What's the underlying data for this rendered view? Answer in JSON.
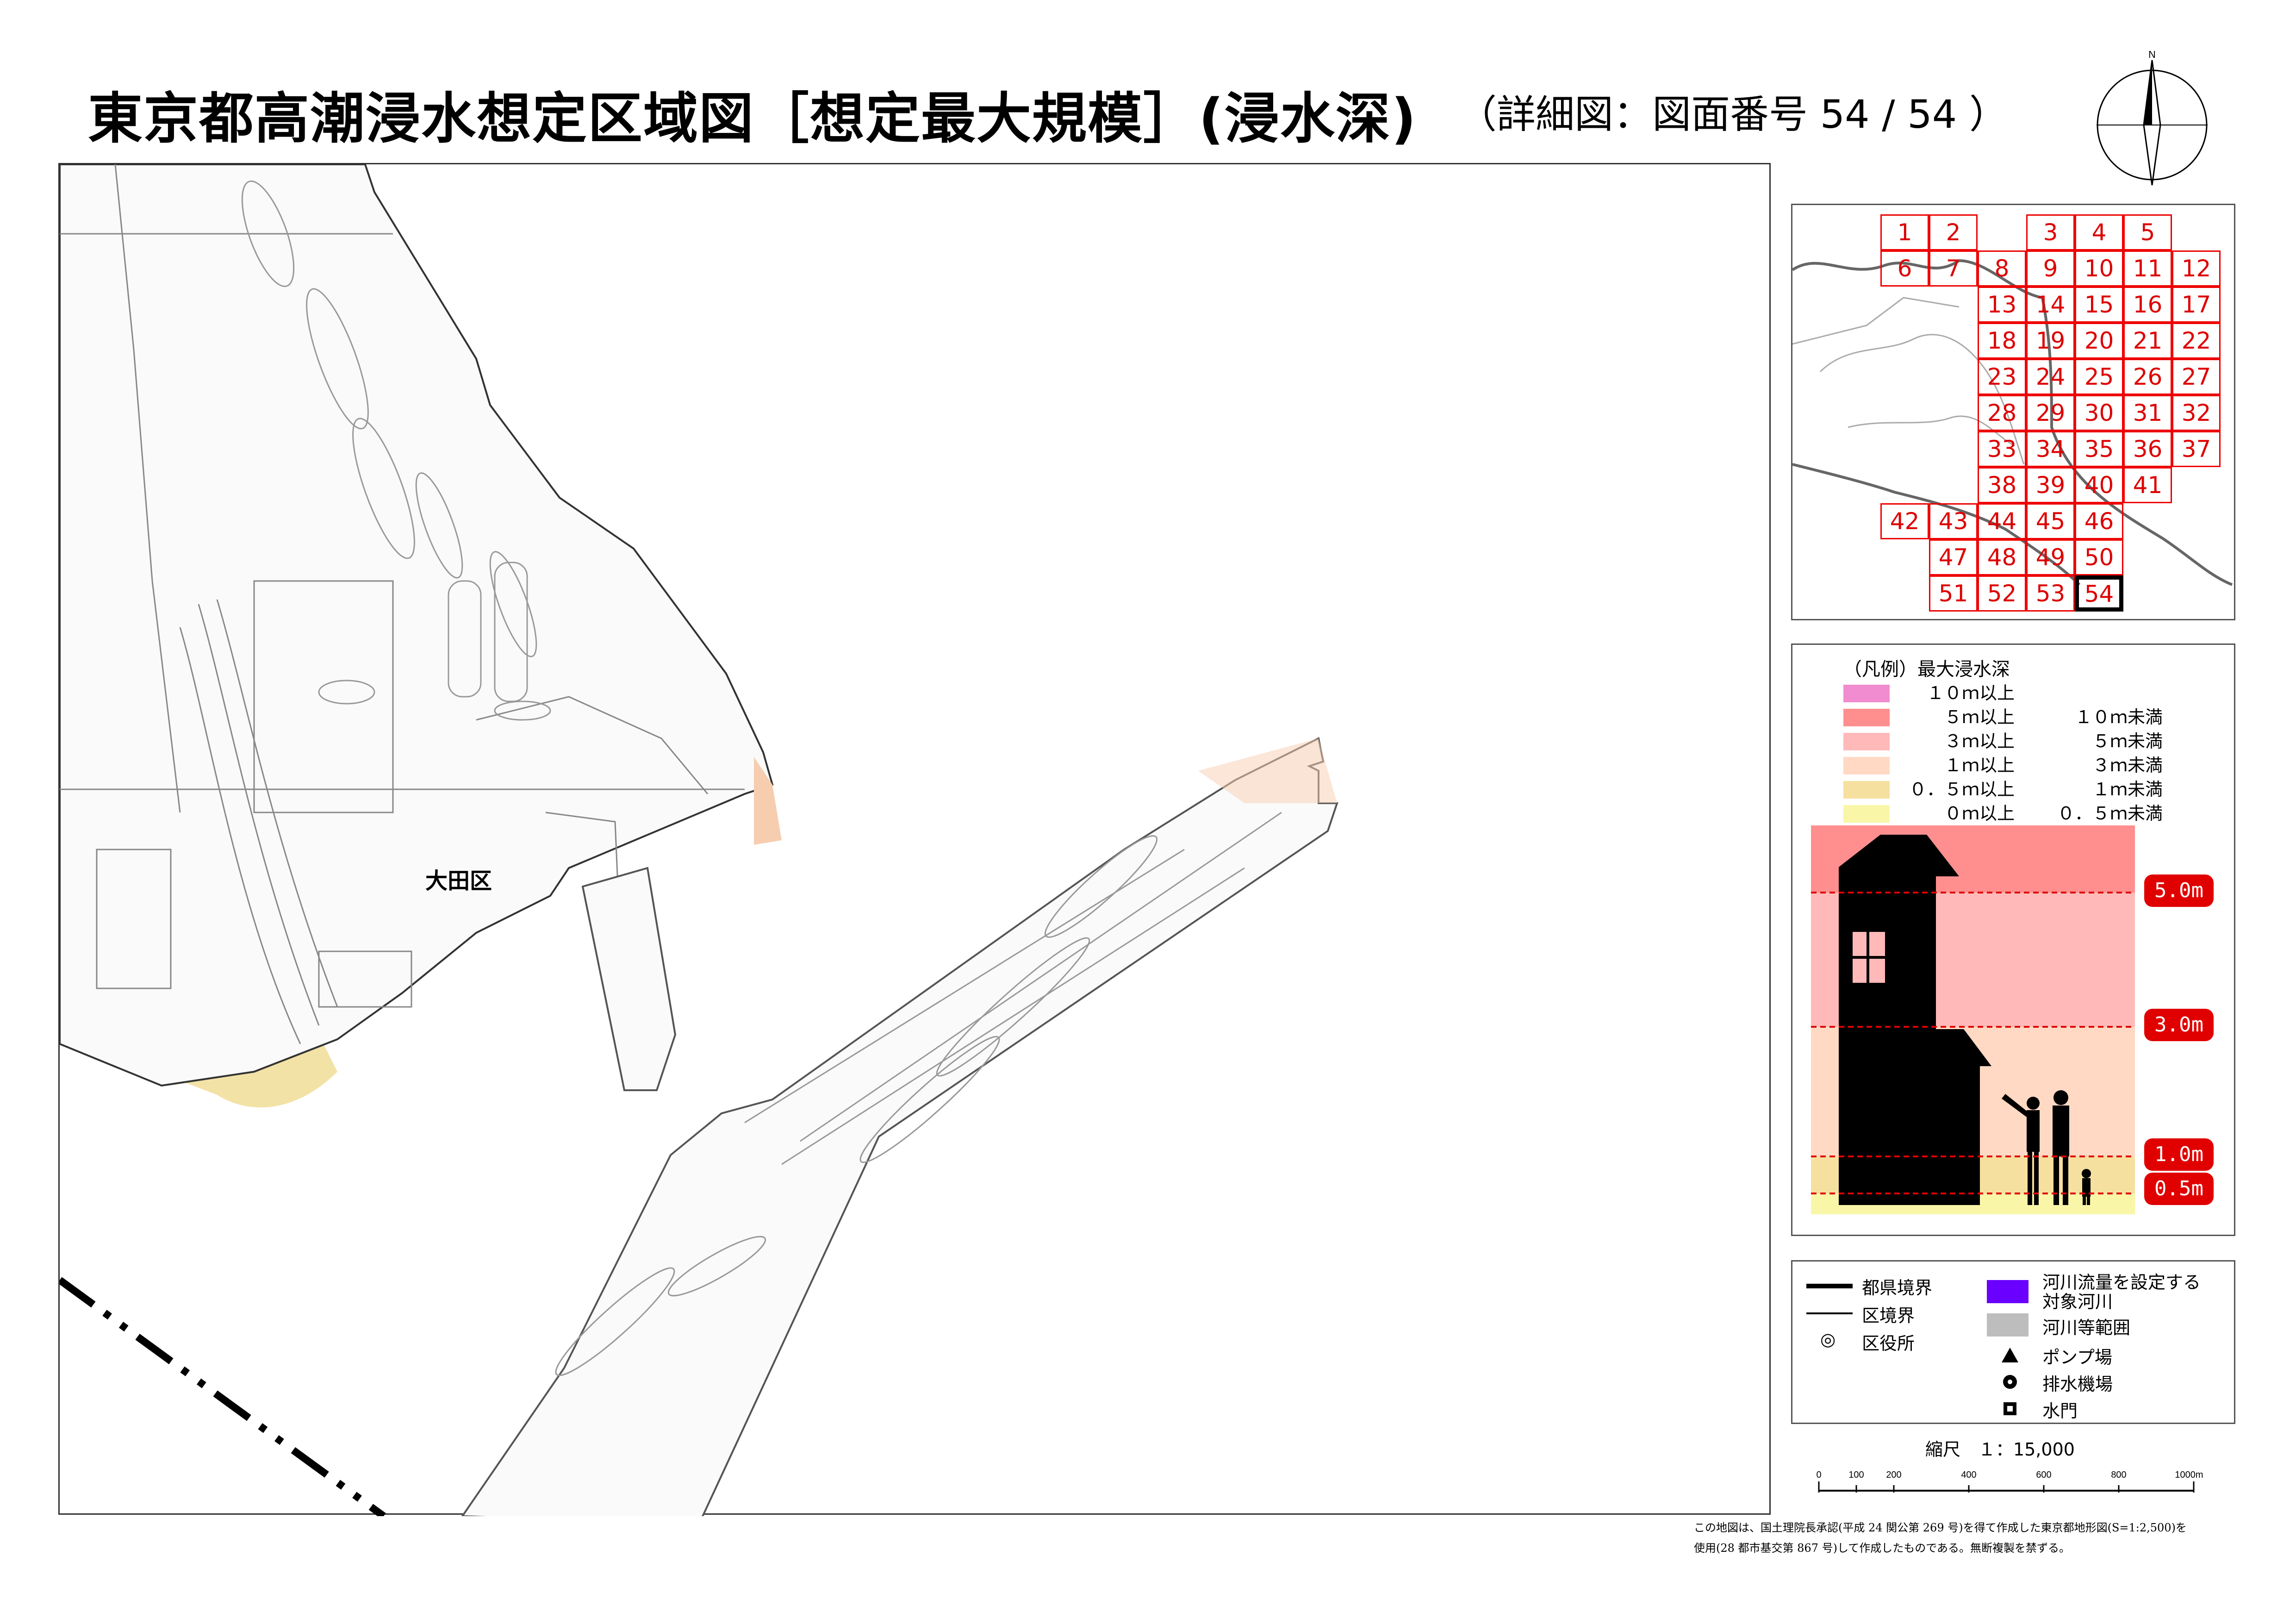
{
  "header": {
    "title": "東京都高潮浸水想定区域図［想定最大規模］(浸水深)",
    "subtitle": "（詳細図：図面番号 54 / 54 ）",
    "north_label": "N"
  },
  "map": {
    "ward_label": "大田区",
    "colors": {
      "line": "#555555",
      "depth_03": "#f3e2a6",
      "depth_13": "#f7cdb0",
      "boundary": "#000000"
    }
  },
  "index_map": {
    "cells": [
      "1",
      "2",
      "3",
      "4",
      "5",
      "6",
      "7",
      "8",
      "9",
      "10",
      "11",
      "12",
      "13",
      "14",
      "15",
      "16",
      "17",
      "18",
      "19",
      "20",
      "21",
      "22",
      "23",
      "24",
      "25",
      "26",
      "27",
      "28",
      "29",
      "30",
      "31",
      "32",
      "33",
      "34",
      "35",
      "36",
      "37",
      "38",
      "39",
      "40",
      "41",
      "42",
      "43",
      "44",
      "45",
      "46",
      "47",
      "48",
      "49",
      "50",
      "51",
      "52",
      "53",
      "54"
    ],
    "current": "54"
  },
  "legend": {
    "title": "（凡例）最大浸水深",
    "rows": [
      {
        "from": "１０ｍ以上",
        "to": "",
        "color": "#f08ccf"
      },
      {
        "from": "５ｍ以上",
        "to": "１０ｍ未満",
        "color": "#ff8f8f"
      },
      {
        "from": "３ｍ以上",
        "to": "５ｍ未満",
        "color": "#ffb9b9"
      },
      {
        "from": "１ｍ以上",
        "to": "３ｍ未満",
        "color": "#ffd9c3"
      },
      {
        "from": "０．５ｍ以上",
        "to": "１ｍ未満",
        "color": "#f6e0a0"
      },
      {
        "from": "０ｍ以上",
        "to": "０．５ｍ未満",
        "color": "#f9f6a8"
      }
    ],
    "depth_tags": [
      "5.0m",
      "3.0m",
      "1.0m",
      "0.5m"
    ]
  },
  "symbols": {
    "prefecture_boundary": "都県境界",
    "ward_boundary": "区境界",
    "ward_office": "区役所",
    "target_river": "河川流量を設定する",
    "target_river_2": "対象河川",
    "river_area": "河川等範囲",
    "pump": "ポンプ場",
    "drainage": "排水機場",
    "sluice": "水門",
    "ward_office_glyph": "◎",
    "target_river_color": "#6a00ff",
    "river_area_color": "#bdbdbd"
  },
  "scale": {
    "label": "縮尺　１：15,000",
    "ticks": [
      "0",
      "100",
      "200",
      "400",
      "600",
      "800",
      "1000m"
    ]
  },
  "disclaimer": {
    "line1": "この地図は、国土理院長承認(平成 24 関公第 269 号)を得て作成した東京都地形図(S=1:2,500)を",
    "line2": "使用(28 都市基交第 867 号)して作成したものである。無断複製を禁ずる。"
  }
}
